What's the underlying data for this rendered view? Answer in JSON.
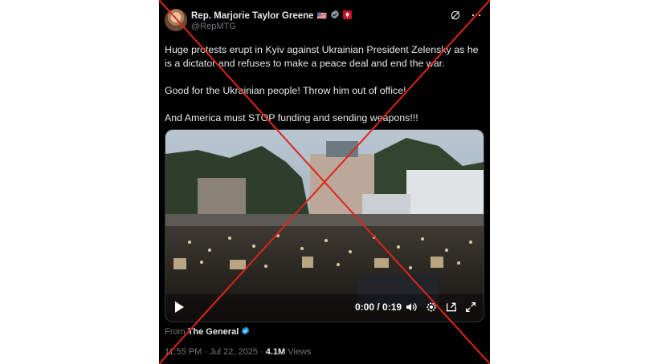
{
  "author": {
    "display_name": "Rep. Marjorie Taylor Greene",
    "flag": "🇺🇸",
    "handle": "@RepMTG"
  },
  "tweet": {
    "paragraphs": [
      "Huge protests erupt in Kyiv against Ukrainian President Zelensky as he is a dictator and refuses to make a peace deal and end the war.",
      "Good for the Ukrainian people! Throw him out of office!",
      "And America must STOP funding and sending weapons!!!"
    ]
  },
  "video": {
    "time_display": "0:00 / 0:19"
  },
  "attribution": {
    "from_label": "From",
    "source_name": "The General"
  },
  "meta": {
    "timestamp": "11:55 PM · Jul 22, 2025 · ",
    "views_count": "4.1M",
    "views_label": " Views"
  },
  "colors": {
    "card_bg": "#000000",
    "text_primary": "#e7e9ea",
    "text_secondary": "#71767b",
    "verified_blue": "#1d9bf0",
    "cross_red": "#e0241b"
  },
  "icons": [
    "avatar",
    "us-flag",
    "verified-badge-icon",
    "government-label-icon",
    "grok-icon",
    "more-icon",
    "play-icon",
    "volume-icon",
    "settings-icon",
    "pip-icon",
    "fullscreen-icon"
  ]
}
